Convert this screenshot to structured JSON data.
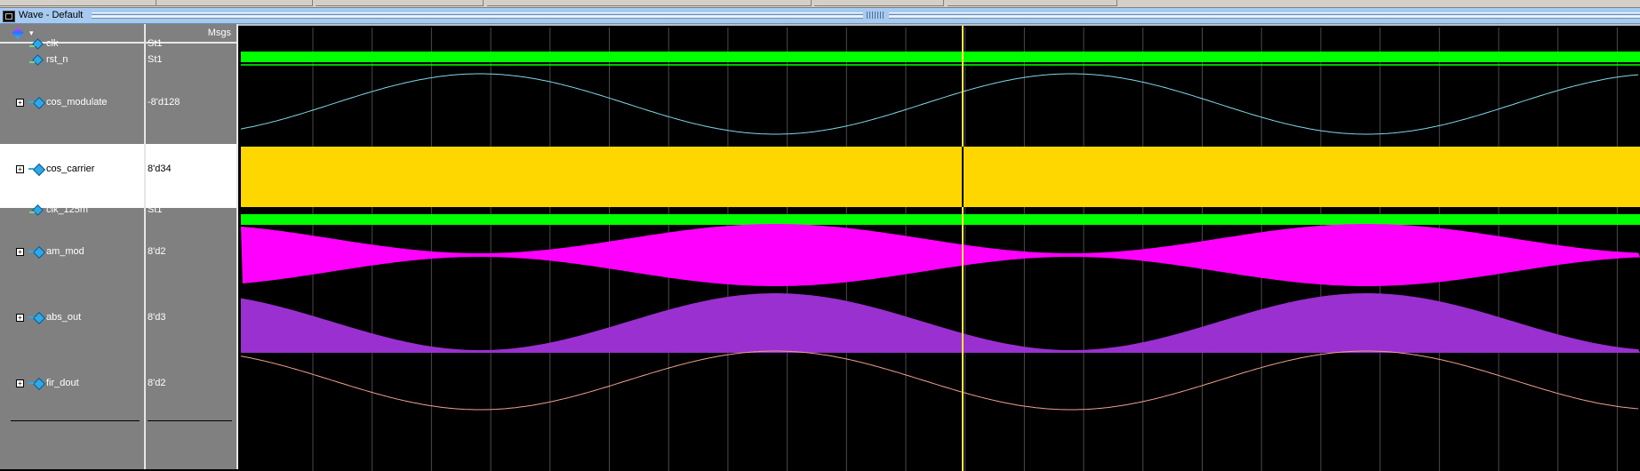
{
  "window": {
    "title": "Wave - Default"
  },
  "columns": {
    "values_header": "Msgs"
  },
  "icons": {
    "toolbar": "wave-tool-icon",
    "dropdown": "dropdown-arrow-icon"
  },
  "signals": [
    {
      "id": "clk",
      "name": "clk",
      "value": "St1",
      "kind": "wire",
      "expandable": false,
      "selected": false,
      "color": "#00ff00"
    },
    {
      "id": "rst_n",
      "name": "rst_n",
      "value": "St1",
      "kind": "wire",
      "expandable": false,
      "selected": false,
      "color": "#00ff00"
    },
    {
      "id": "cos_modulate",
      "name": "cos_modulate",
      "value": "-8'd128",
      "kind": "bus",
      "expandable": true,
      "selected": false,
      "color": "#7fd8e8"
    },
    {
      "id": "cos_carrier",
      "name": "cos_carrier",
      "value": "8'd34",
      "kind": "bus",
      "expandable": true,
      "selected": true,
      "color": "#ffd700"
    },
    {
      "id": "clk_125m",
      "name": "clk_125m",
      "value": "St1",
      "kind": "wire",
      "expandable": false,
      "selected": false,
      "color": "#00ff00"
    },
    {
      "id": "am_mod",
      "name": "am_mod",
      "value": "8'd2",
      "kind": "bus",
      "expandable": true,
      "selected": false,
      "color": "#ff00ff"
    },
    {
      "id": "abs_out",
      "name": "abs_out",
      "value": "8'd3",
      "kind": "bus",
      "expandable": true,
      "selected": false,
      "color": "#9b30d0"
    },
    {
      "id": "fir_dout",
      "name": "fir_dout",
      "value": "8'd2",
      "kind": "bus",
      "expandable": true,
      "selected": false,
      "color": "#f0a090"
    }
  ],
  "cursor": {
    "color": "#ffe640"
  }
}
